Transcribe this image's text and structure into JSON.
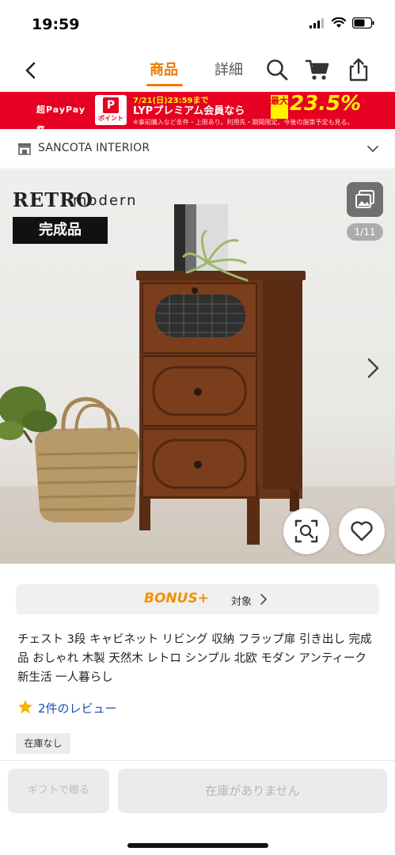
{
  "status_bar": {
    "time": "19:59",
    "icons": [
      "signal-icon",
      "wifi-icon",
      "battery-icon"
    ]
  },
  "nav": {
    "tabs": [
      {
        "label": "商品",
        "active": true
      },
      {
        "label": "詳細",
        "active": false
      }
    ],
    "icons": [
      "back-icon",
      "search-icon",
      "cart-icon",
      "share-icon"
    ],
    "accent_color": "#ee7b00"
  },
  "banner": {
    "logo": "超PayPay祭",
    "point_label": "ポイント",
    "line1": "7/21(日)23:59まで",
    "line2": "LYPプレミアム会員なら",
    "max_label": "最大",
    "rate": "23.5%",
    "note": "※事前購入など条件・上限あり。利用先・期間限定。今後の施策予定も見る。",
    "color": "#e60021"
  },
  "store": {
    "name": "SANCOTA INTERIOR"
  },
  "product_image": {
    "title_main": "RETRO",
    "title_sub": "modern",
    "badge": "完成品",
    "counter": "1/11"
  },
  "bonus": {
    "label": "BONUS+",
    "target": "対象"
  },
  "product": {
    "title": "チェスト 3段 キャビネット リビング 収納 フラップ扉 引き出し 完成品 おしゃれ 木製 天然木 レトロ シンプル 北欧 モダン アンティーク 新生活 一人暮らし",
    "review_link": "2件のレビュー",
    "rating_color": "#f4b400",
    "stock_tag": "在庫なし"
  },
  "bottom_bar": {
    "gift_button": "ギフトで贈る",
    "primary_button": "在庫がありません"
  }
}
